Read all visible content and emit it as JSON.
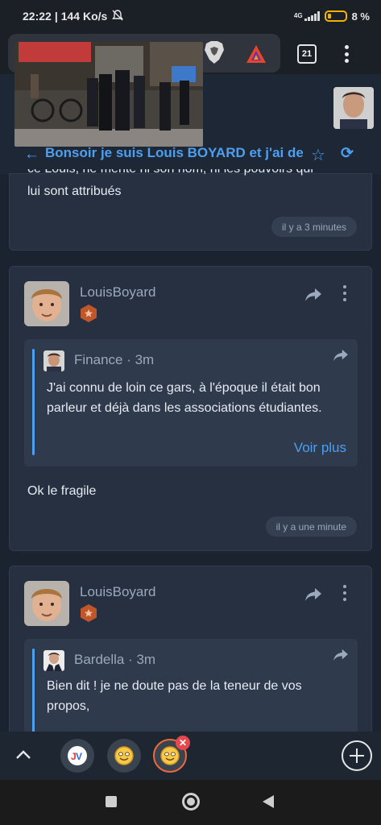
{
  "status_bar": {
    "time": "22:22",
    "speed": "144 Ko/s",
    "network": "4G",
    "battery": "8 %"
  },
  "browser": {
    "tab_count": "21"
  },
  "topic": {
    "title": "Bonsoir je suis Louis BOYARD et j'ai de"
  },
  "posts": [
    {
      "body_line_cut": "ce Louis, ne mente ni son nom, ni les pouvoirs qui",
      "body_line": "lui sont attribués",
      "time": "il y a 3 minutes"
    },
    {
      "author": "LouisBoyard",
      "quote": {
        "author_time": "Finance · 3m",
        "text": "J'ai connu de loin ce gars, à l'époque il était bon parleur et déjà dans les associations étudiantes.",
        "more": "Voir plus"
      },
      "body": "Ok le fragile",
      "time": "il y a une minute"
    },
    {
      "author": "LouisBoyard",
      "quote": {
        "author_time": "Bardella · 3m",
        "text": "Bien dit ! je ne doute pas de la teneur de vos propos,"
      }
    }
  ],
  "bottom_bar": {
    "tab1_icon": "jv-logo-icon",
    "tab2_icon": "smiley-icon",
    "tab3_icon": "smiley-icon"
  },
  "colors": {
    "accent": "#4d9ff0",
    "background": "#1b2330",
    "card": "#263041",
    "badge": "#c0572a"
  }
}
